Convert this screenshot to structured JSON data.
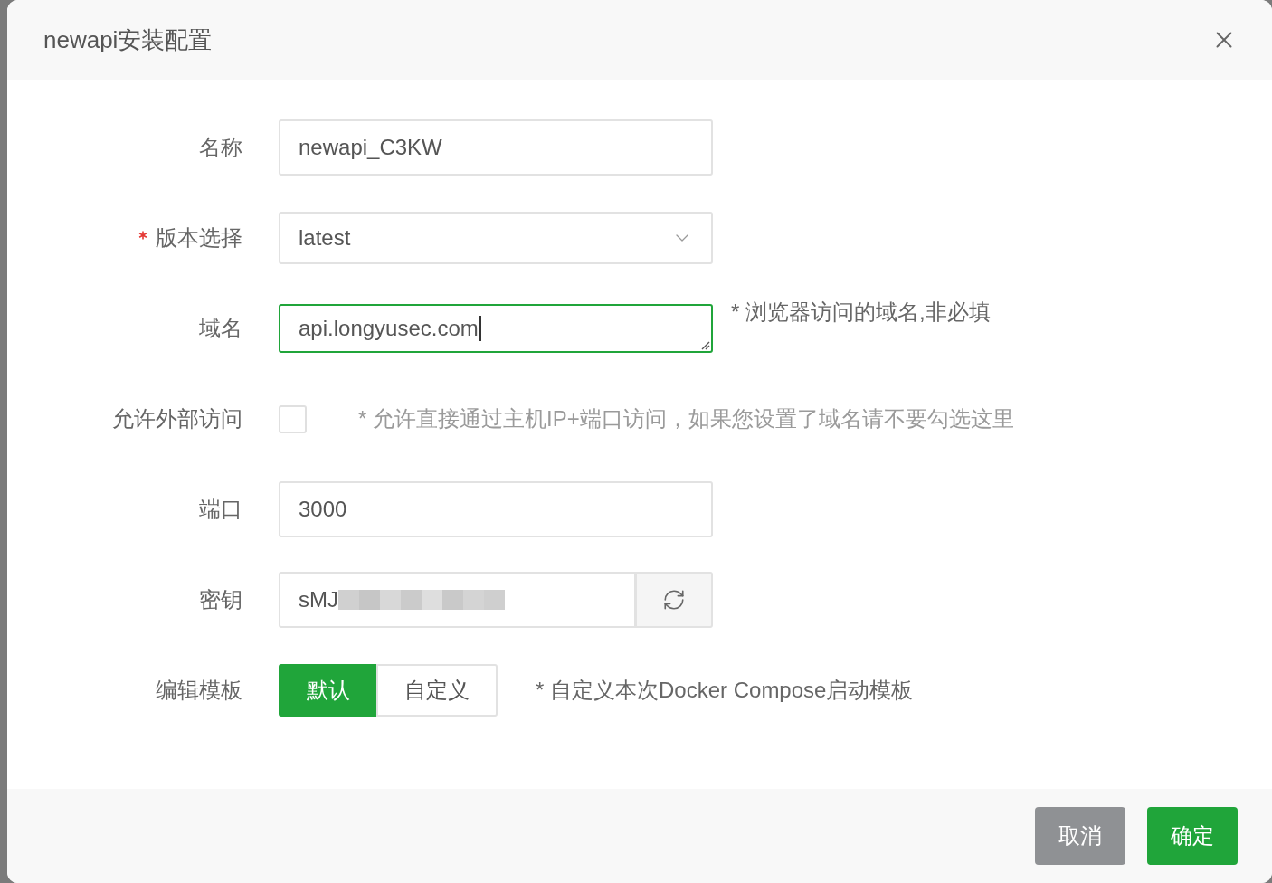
{
  "dialog": {
    "title": "newapi安装配置"
  },
  "form": {
    "fields": [
      {
        "kind": "text",
        "label": "名称",
        "required": false,
        "focused": false,
        "value": "newapi_C3KW"
      },
      {
        "kind": "select",
        "label": "版本选择",
        "required": true,
        "focused": false,
        "value": "latest"
      },
      {
        "kind": "textarea",
        "label": "域名",
        "required": false,
        "focused": true,
        "value": "api.longyusec.com",
        "hint": {
          "text": "* 浏览器访问的域名,非必填",
          "muted": false
        }
      },
      {
        "kind": "checkbox",
        "label": "允许外部访问",
        "required": false,
        "focused": false,
        "checked": false,
        "hint": {
          "text": "* 允许直接通过主机IP+端口访问，如果您设置了域名请不要勾选这里",
          "muted": true
        }
      },
      {
        "kind": "text",
        "label": "端口",
        "required": false,
        "focused": false,
        "value": "3000"
      },
      {
        "kind": "secret",
        "label": "密钥",
        "required": false,
        "focused": false,
        "value": "sMJ"
      },
      {
        "kind": "segmented",
        "label": "编辑模板",
        "required": false,
        "focused": false,
        "options": [
          {
            "label": "默认",
            "selected": true
          },
          {
            "label": "自定义",
            "selected": false
          }
        ],
        "hint": {
          "text": "* 自定义本次Docker Compose启动模板",
          "muted": false
        }
      }
    ]
  },
  "footer": {
    "buttons": [
      {
        "kind": "secondary",
        "label": "取消"
      },
      {
        "kind": "primary",
        "label": "确定"
      }
    ]
  }
}
